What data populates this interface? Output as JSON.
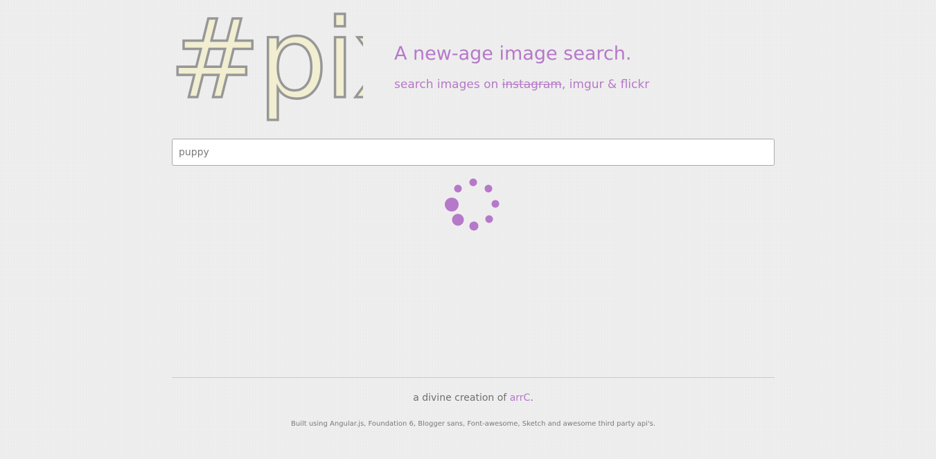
{
  "logo": {
    "text": "#pix"
  },
  "header": {
    "tagline": "A new-age image search.",
    "sub_prefix": "search images on ",
    "sub_strike": "instagram",
    "sub_suffix": ", imgur & flickr"
  },
  "search": {
    "value": "puppy",
    "placeholder": ""
  },
  "spinner": {
    "icon": "loading-spinner-icon",
    "color": "#b678c9"
  },
  "footer": {
    "credit_prefix": "a divine creation of ",
    "credit_link": "arrC",
    "credit_suffix": ".",
    "built_with": "Built using Angular.js, Foundation 6, Blogger sans, Font-awesome, Sketch and awesome third party api's."
  },
  "colors": {
    "accent": "#b678c9",
    "logo_fill": "#f1eed1",
    "logo_stroke": "#979797",
    "background": "#efefef"
  }
}
